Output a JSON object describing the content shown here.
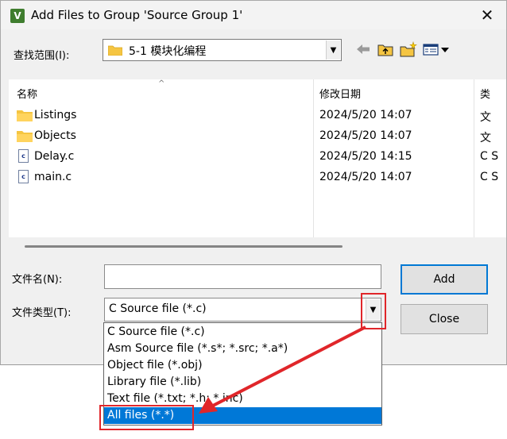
{
  "window": {
    "title": "Add Files to Group 'Source Group 1'",
    "app_icon_letter": "V",
    "close_glyph": "✕"
  },
  "look_in": {
    "label": "查找范围(I):",
    "value": "5-1 模块化编程"
  },
  "toolbar": {
    "icons": [
      "back-icon",
      "up-folder-icon",
      "new-folder-icon",
      "view-menu-icon"
    ]
  },
  "file_list": {
    "columns": [
      "名称",
      "修改日期",
      "类"
    ],
    "rows": [
      {
        "icon": "folder-icon",
        "name": "Listings",
        "date": "2024/5/20 14:07",
        "type": "文"
      },
      {
        "icon": "folder-icon",
        "name": "Objects",
        "date": "2024/5/20 14:07",
        "type": "文"
      },
      {
        "icon": "c-file-icon",
        "name": "Delay.c",
        "date": "2024/5/20 14:15",
        "type": "C S"
      },
      {
        "icon": "c-file-icon",
        "name": "main.c",
        "date": "2024/5/20 14:07",
        "type": "C S"
      }
    ]
  },
  "file_name": {
    "label": "文件名(N):",
    "value": ""
  },
  "file_type": {
    "label": "文件类型(T):",
    "value": "C Source file (*.c)",
    "options": [
      "C Source file (*.c)",
      "Asm Source file (*.s*; *.src; *.a*)",
      "Object file (*.obj)",
      "Library file (*.lib)",
      "Text file (*.txt; *.h; *.inc)",
      "All files (*.*)"
    ],
    "selected_index": 5
  },
  "buttons": {
    "add": "Add",
    "close": "Close"
  },
  "colors": {
    "annotation": "#e0262a",
    "selection": "#0078d7",
    "folder": "#f5c542"
  }
}
